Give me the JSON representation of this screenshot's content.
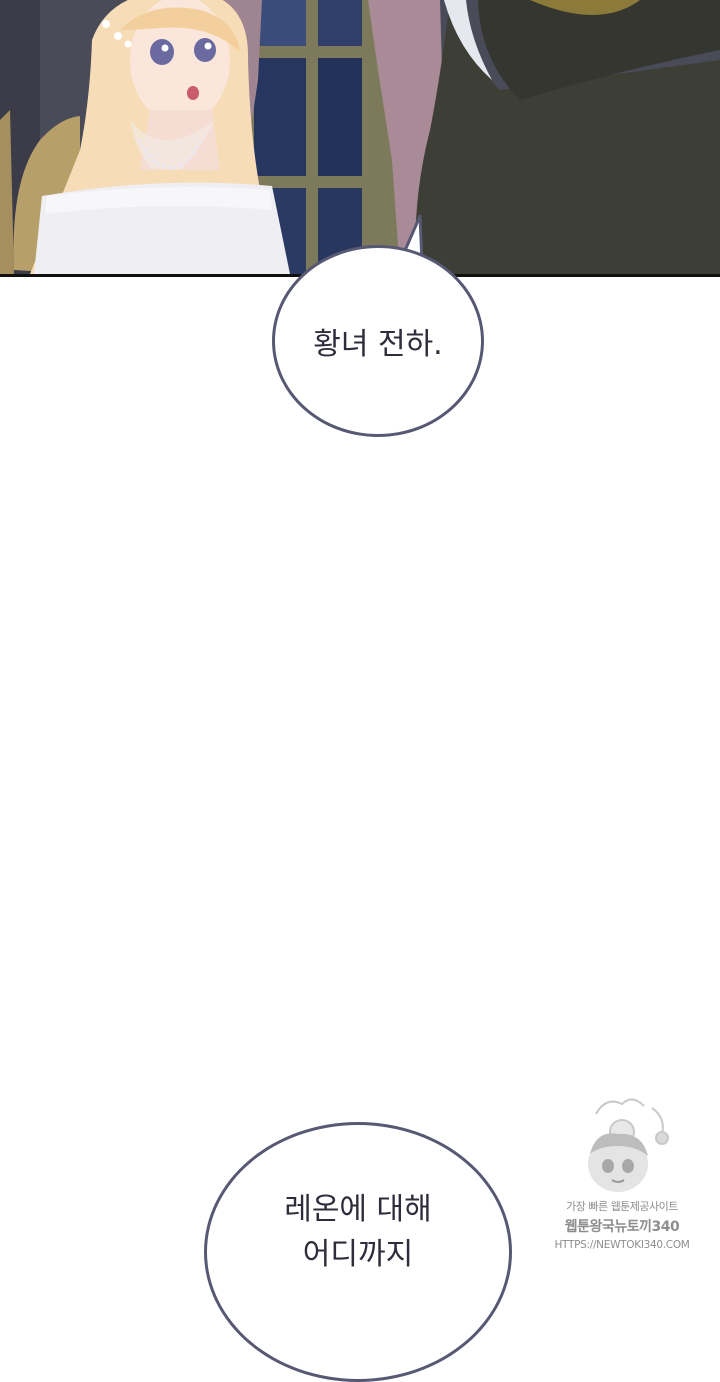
{
  "panel": {
    "colors": {
      "night_sky": "#25345a",
      "curtain": "#9e8591",
      "hair": "#f7dcb8",
      "dress": "#eeeef3",
      "cloak": "#3d3e36"
    }
  },
  "speech": {
    "first": "황녀 전하.",
    "second_line_1": "레온에 대해",
    "second_line_2": "어디까지"
  },
  "watermark": {
    "line_1": "가장 빠른 웹툰제공사이트",
    "line_2": "웹툰왕국뉴토끼340",
    "line_3": "HTTPS://NEWTOKI340.COM"
  }
}
